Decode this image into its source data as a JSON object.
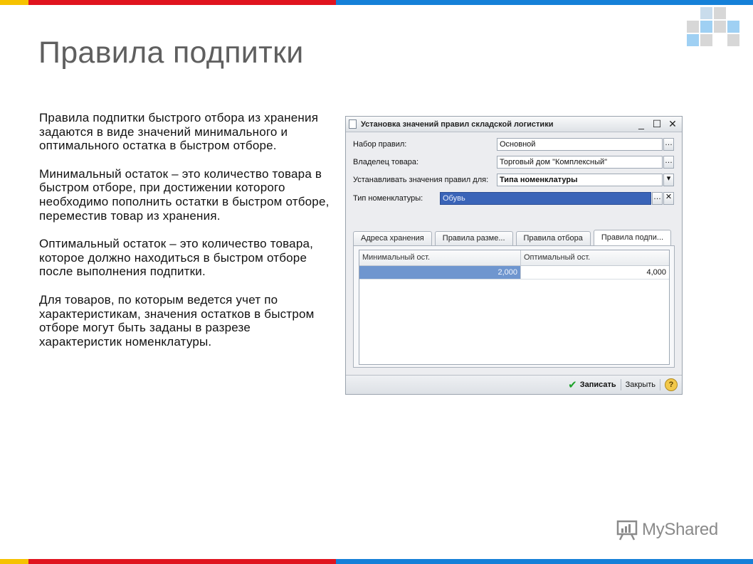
{
  "slide": {
    "title": "Правила подпитки",
    "paragraphs": [
      "Правила подпитки быстрого отбора из хранения задаются в виде значений минимального и оптимального остатка в быстром отборе.",
      "Минимальный остаток – это количество товара в быстром отборе, при достижении которого необходимо пополнить остатки в быстром отборе, переместив товар из хранения.",
      "Оптимальный остаток – это количество товара, которое должно находиться в быстром отборе после выполнения подпитки.",
      "Для товаров, по которым ведется учет по характеристикам, значения остатков в быстром отборе могут быть заданы в разрезе характеристик номенклатуры."
    ],
    "colors": {
      "bar_yellow": "#f6c200",
      "bar_red": "#e0141e",
      "bar_blue": "#1580d8",
      "title": "#5f5f5f",
      "selected_row": "#6f96cf"
    }
  },
  "window": {
    "title": "Установка значений правил складской логистики",
    "controls": [
      "minimize",
      "maximize",
      "close"
    ],
    "fields": [
      {
        "label": "Набор правил:",
        "value": "Основной"
      },
      {
        "label": "Владелец товара:",
        "value": "Торговый дом \"Комплексный\""
      },
      {
        "label": "Устанавливать значения правил для:",
        "value": "Типа номенклатуры"
      },
      {
        "label": "Тип номенклатуры:",
        "value": "Обувь"
      }
    ],
    "tabs": [
      "Адреса хранения",
      "Правила разме...",
      "Правила отбора",
      "Правила подпи..."
    ],
    "active_tab": "Правила подпи...",
    "table": {
      "columns": [
        "Минимальный ост.",
        "Оптимальный ост."
      ],
      "rows": [
        [
          "2,000",
          "4,000"
        ]
      ]
    },
    "footer": {
      "save_label": "Записать",
      "close_label": "Закрыть",
      "help_label": "?"
    }
  },
  "watermark": {
    "text": "MyShared"
  }
}
